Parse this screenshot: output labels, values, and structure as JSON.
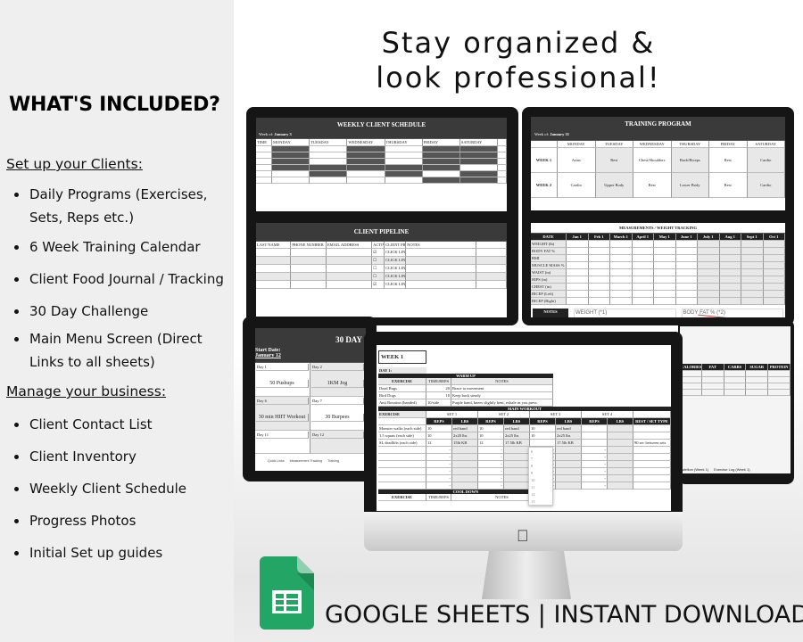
{
  "headline": {
    "line1": "Stay organized &",
    "line2": "look professional!"
  },
  "included": {
    "title": "WHAT'S INCLUDED?",
    "sections": [
      {
        "heading": "Set up your Clients:",
        "items": [
          "Daily Programs  (Exercises, Sets, Reps etc.)",
          "6 Week Training Calendar",
          "Client Food Journal / Tracking",
          "30 Day Challenge",
          "Main Menu Screen (Direct Links to all sheets)"
        ]
      },
      {
        "heading": "Manage your business:",
        "items": [
          "Client Contact List",
          "Client Inventory",
          "Weekly Client Schedule",
          "Progress Photos",
          "Initial Set up guides"
        ]
      }
    ]
  },
  "schedule": {
    "title": "WEEKLY CLIENT SCHEDULE",
    "week_label": "Week of:",
    "week": "January 3",
    "days": [
      "MONDAY",
      "TUESDAY",
      "WEDNESDAY",
      "THURSDAY",
      "FRIDAY",
      "SATURDAY"
    ],
    "time_header": "TIME"
  },
  "training": {
    "title": "TRAINING PROGRAM",
    "week_label": "Week of:",
    "week": "January 31",
    "days": [
      "MONDAY",
      "TUESDAY",
      "WEDNESDAY",
      "THURSDAY",
      "FRIDAY",
      "SATURDAY"
    ],
    "rows": [
      {
        "label": "WEEK 1",
        "cells": [
          "Arms",
          "Rest",
          "Chest/Shoulders",
          "Back/Biceps",
          "Rest",
          "Cardio"
        ]
      },
      {
        "label": "WEEK 2",
        "cells": [
          "Cardio",
          "Upper Body",
          "Rest",
          "Lower Body",
          "Rest",
          "Cardio"
        ]
      }
    ]
  },
  "pipeline": {
    "title": "CLIENT PIPELINE",
    "headers": [
      "LAST NAME",
      "PHONE NUMBER",
      "EMAIL ADDRESS",
      "ACTIVE",
      "CLIENT PROGRAM LINK",
      "NOTES"
    ],
    "link": "CLICK LINK"
  },
  "measure": {
    "title": "MEASUREMENTS / WEIGHT TRACKING",
    "headers": [
      "DATE",
      "Jan 1",
      "Feb 1",
      "March 1",
      "April 1",
      "May 1",
      "June 1",
      "July 1",
      "Aug 1",
      "Sept 1",
      "Oct 1"
    ],
    "rows": [
      "WEIGHT (lb)",
      "BODY FAT %",
      "BMI",
      "MUSCLE MASS %",
      "WAIST (in)",
      "HIPS (in)",
      "CHEST (in)",
      "BICEP (Left)",
      "BICEP (Right)"
    ],
    "notes": "NOTES",
    "chart1": "WEIGHT (*1)",
    "chart2": "BODY FAT % (*2)"
  },
  "challenge": {
    "title": "30 DAY",
    "start_label": "Start Date:",
    "start": "January 12",
    "cells": [
      {
        "day": "Day 1",
        "task": "50 Pushups"
      },
      {
        "day": "Day 2",
        "task": "1KM Jog"
      },
      {
        "day": "Day 6",
        "task": "30 min HIIT Workout"
      },
      {
        "day": "Day 7",
        "task": "30 Burpees"
      },
      {
        "day": "Day 11",
        "task": ""
      },
      {
        "day": "Day 12",
        "task": ""
      }
    ],
    "tabs": [
      "Quick Links",
      "Measurement Tracking",
      "Training"
    ]
  },
  "program": {
    "week": "WEEK 1",
    "day": "DAY 1:",
    "warmup": "WARM UP",
    "main": "MAIN WORKOUT",
    "cooldown": "COOL DOWN",
    "cols": [
      "EXERCISE",
      "TIME/REPS",
      "NOTES"
    ],
    "warm_rows": [
      [
        "Dead Bugs",
        "20",
        "Brace to movement"
      ],
      [
        "Bird Dogs",
        "10",
        "Keep back steady"
      ],
      [
        "Anti Rotation (banded)",
        "10/side",
        "Purple band, knees slightly bent, exhale as you press"
      ]
    ],
    "sets": [
      "SET 1",
      "SET 2",
      "SET 3",
      "SET 4"
    ],
    "sub": [
      "REPS",
      "LBS"
    ],
    "rest": "REST / SET TYPE",
    "main_rows": [
      [
        "Monster walks (each side)",
        "10",
        "red band",
        "10",
        "red band",
        "10",
        "red band"
      ],
      [
        "1.5 squats (each side)",
        "10",
        "2x20 lbs",
        "10",
        "2x25 lbs",
        "10",
        "2x25 lbs"
      ],
      [
        "SL deadlifts (each side)",
        "12",
        "15lb KB",
        "12",
        "17.5lb KB",
        "",
        "17.5lb KB",
        "90 sec between sets"
      ]
    ],
    "dropdown": [
      "6",
      "7",
      "8",
      "9",
      "10",
      "11",
      "12",
      "13"
    ]
  },
  "food": {
    "headers": [
      "CALORIES",
      "FAT",
      "CARBS",
      "SUGAR",
      "PROTEIN"
    ],
    "tabs": [
      "Nutrition (Week 1)",
      "Exercise Log (Week 1)"
    ]
  },
  "footer": {
    "text": "GOOGLE SHEETS | INSTANT DOWNLOAD"
  },
  "colors": {
    "sheets_green": "#23a566",
    "panel": "#efefef",
    "sheet_header": "#3a3a3a"
  }
}
